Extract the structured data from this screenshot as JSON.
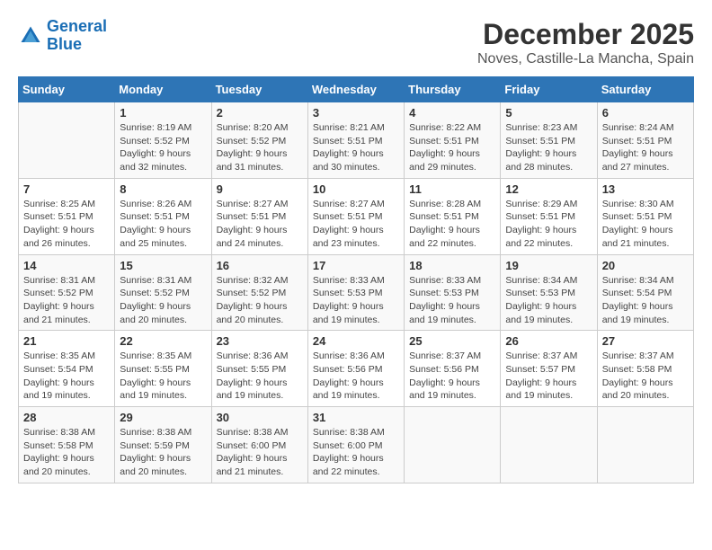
{
  "header": {
    "logo_line1": "General",
    "logo_line2": "Blue",
    "title": "December 2025",
    "subtitle": "Noves, Castille-La Mancha, Spain"
  },
  "weekdays": [
    "Sunday",
    "Monday",
    "Tuesday",
    "Wednesday",
    "Thursday",
    "Friday",
    "Saturday"
  ],
  "weeks": [
    [
      {
        "day": "",
        "empty": true
      },
      {
        "day": "1",
        "sunrise": "8:19 AM",
        "sunset": "5:52 PM",
        "daylight": "9 hours and 32 minutes."
      },
      {
        "day": "2",
        "sunrise": "8:20 AM",
        "sunset": "5:52 PM",
        "daylight": "9 hours and 31 minutes."
      },
      {
        "day": "3",
        "sunrise": "8:21 AM",
        "sunset": "5:51 PM",
        "daylight": "9 hours and 30 minutes."
      },
      {
        "day": "4",
        "sunrise": "8:22 AM",
        "sunset": "5:51 PM",
        "daylight": "9 hours and 29 minutes."
      },
      {
        "day": "5",
        "sunrise": "8:23 AM",
        "sunset": "5:51 PM",
        "daylight": "9 hours and 28 minutes."
      },
      {
        "day": "6",
        "sunrise": "8:24 AM",
        "sunset": "5:51 PM",
        "daylight": "9 hours and 27 minutes."
      }
    ],
    [
      {
        "day": "7",
        "sunrise": "8:25 AM",
        "sunset": "5:51 PM",
        "daylight": "9 hours and 26 minutes."
      },
      {
        "day": "8",
        "sunrise": "8:26 AM",
        "sunset": "5:51 PM",
        "daylight": "9 hours and 25 minutes."
      },
      {
        "day": "9",
        "sunrise": "8:27 AM",
        "sunset": "5:51 PM",
        "daylight": "9 hours and 24 minutes."
      },
      {
        "day": "10",
        "sunrise": "8:27 AM",
        "sunset": "5:51 PM",
        "daylight": "9 hours and 23 minutes."
      },
      {
        "day": "11",
        "sunrise": "8:28 AM",
        "sunset": "5:51 PM",
        "daylight": "9 hours and 22 minutes."
      },
      {
        "day": "12",
        "sunrise": "8:29 AM",
        "sunset": "5:51 PM",
        "daylight": "9 hours and 22 minutes."
      },
      {
        "day": "13",
        "sunrise": "8:30 AM",
        "sunset": "5:51 PM",
        "daylight": "9 hours and 21 minutes."
      }
    ],
    [
      {
        "day": "14",
        "sunrise": "8:31 AM",
        "sunset": "5:52 PM",
        "daylight": "9 hours and 21 minutes."
      },
      {
        "day": "15",
        "sunrise": "8:31 AM",
        "sunset": "5:52 PM",
        "daylight": "9 hours and 20 minutes."
      },
      {
        "day": "16",
        "sunrise": "8:32 AM",
        "sunset": "5:52 PM",
        "daylight": "9 hours and 20 minutes."
      },
      {
        "day": "17",
        "sunrise": "8:33 AM",
        "sunset": "5:53 PM",
        "daylight": "9 hours and 19 minutes."
      },
      {
        "day": "18",
        "sunrise": "8:33 AM",
        "sunset": "5:53 PM",
        "daylight": "9 hours and 19 minutes."
      },
      {
        "day": "19",
        "sunrise": "8:34 AM",
        "sunset": "5:53 PM",
        "daylight": "9 hours and 19 minutes."
      },
      {
        "day": "20",
        "sunrise": "8:34 AM",
        "sunset": "5:54 PM",
        "daylight": "9 hours and 19 minutes."
      }
    ],
    [
      {
        "day": "21",
        "sunrise": "8:35 AM",
        "sunset": "5:54 PM",
        "daylight": "9 hours and 19 minutes."
      },
      {
        "day": "22",
        "sunrise": "8:35 AM",
        "sunset": "5:55 PM",
        "daylight": "9 hours and 19 minutes."
      },
      {
        "day": "23",
        "sunrise": "8:36 AM",
        "sunset": "5:55 PM",
        "daylight": "9 hours and 19 minutes."
      },
      {
        "day": "24",
        "sunrise": "8:36 AM",
        "sunset": "5:56 PM",
        "daylight": "9 hours and 19 minutes."
      },
      {
        "day": "25",
        "sunrise": "8:37 AM",
        "sunset": "5:56 PM",
        "daylight": "9 hours and 19 minutes."
      },
      {
        "day": "26",
        "sunrise": "8:37 AM",
        "sunset": "5:57 PM",
        "daylight": "9 hours and 19 minutes."
      },
      {
        "day": "27",
        "sunrise": "8:37 AM",
        "sunset": "5:58 PM",
        "daylight": "9 hours and 20 minutes."
      }
    ],
    [
      {
        "day": "28",
        "sunrise": "8:38 AM",
        "sunset": "5:58 PM",
        "daylight": "9 hours and 20 minutes."
      },
      {
        "day": "29",
        "sunrise": "8:38 AM",
        "sunset": "5:59 PM",
        "daylight": "9 hours and 20 minutes."
      },
      {
        "day": "30",
        "sunrise": "8:38 AM",
        "sunset": "6:00 PM",
        "daylight": "9 hours and 21 minutes."
      },
      {
        "day": "31",
        "sunrise": "8:38 AM",
        "sunset": "6:00 PM",
        "daylight": "9 hours and 22 minutes."
      },
      {
        "day": "",
        "empty": true
      },
      {
        "day": "",
        "empty": true
      },
      {
        "day": "",
        "empty": true
      }
    ]
  ]
}
